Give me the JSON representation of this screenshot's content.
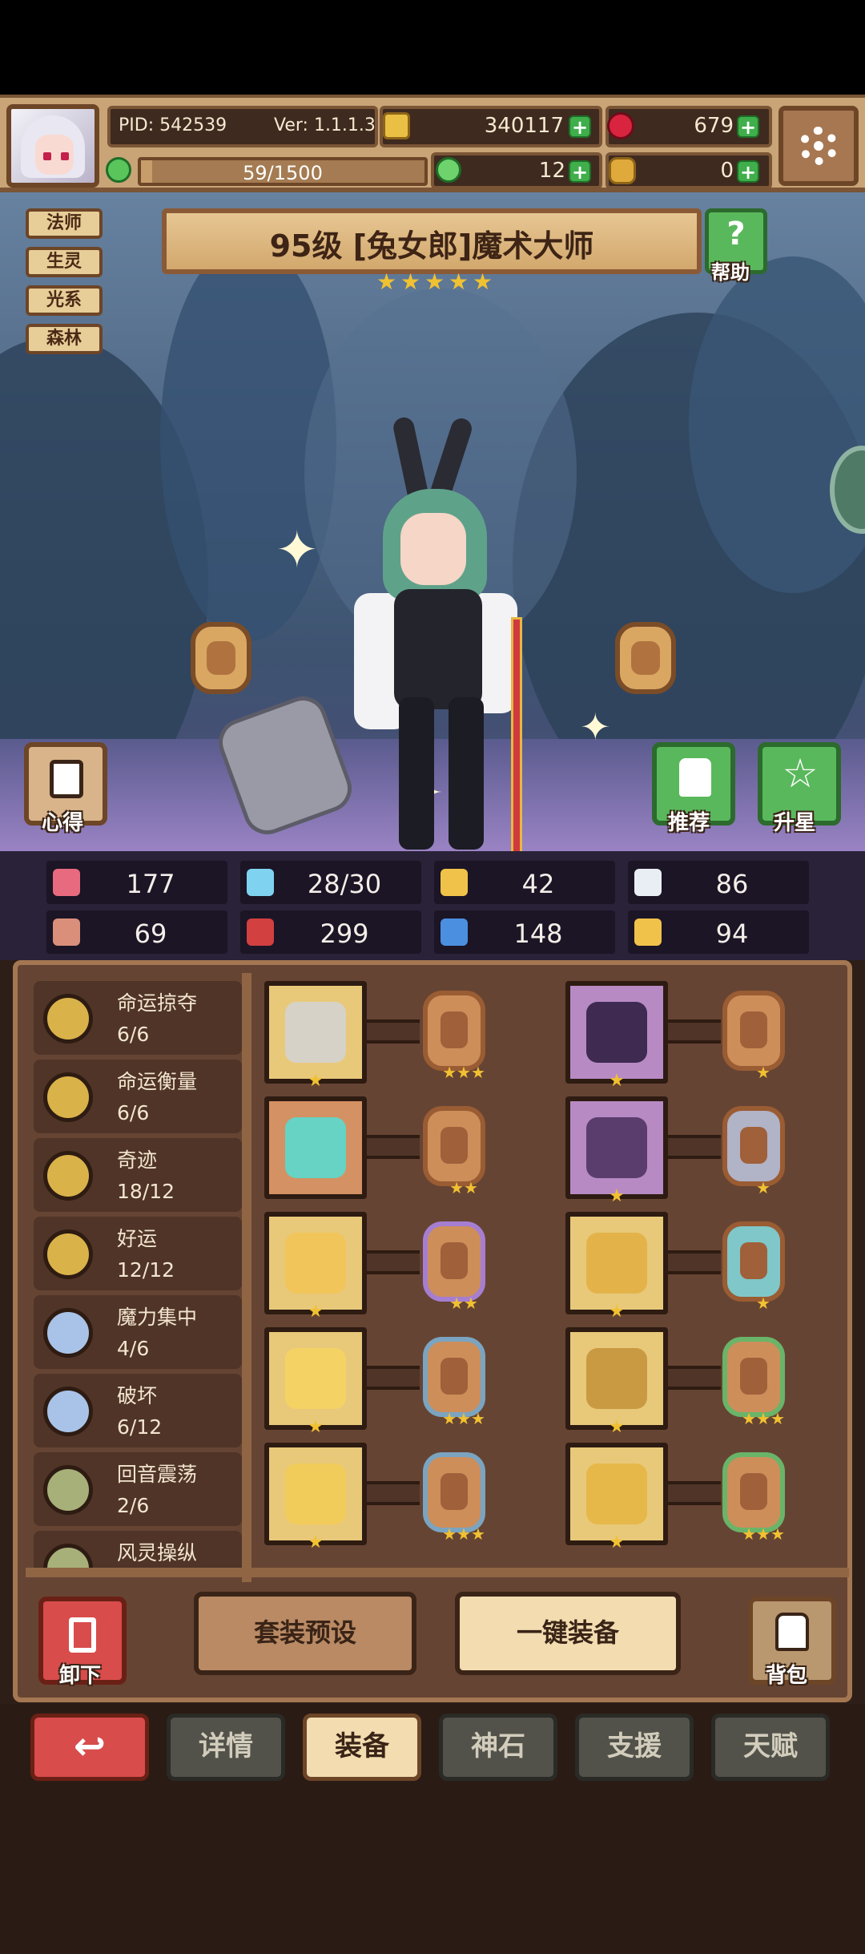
{
  "header": {
    "pid": "PID: 542539",
    "version": "Ver: 1.1.1.3",
    "gold": "340117",
    "gems": "679",
    "stamina": "59/1500",
    "stamina_fraction": 0.039,
    "clover": "12",
    "items": "0"
  },
  "tags": [
    "法师",
    "生灵",
    "光系",
    "森林"
  ],
  "hero": {
    "title": "95级  [兔女郎]魔术大师",
    "stars": 5,
    "help_label": "帮助"
  },
  "scene_buttons": {
    "notes": "心得",
    "recommend": "推荐",
    "star_up": "升星"
  },
  "stats": [
    {
      "icon": "heart-icon",
      "value": "177",
      "color": "#e86a7e"
    },
    {
      "icon": "drop-icon",
      "value": "28/30",
      "color": "#7fd3f0"
    },
    {
      "icon": "shield-icon",
      "value": "42",
      "color": "#f1c24a"
    },
    {
      "icon": "wing-icon",
      "value": "86",
      "color": "#e9eef5"
    },
    {
      "icon": "fist-icon",
      "value": "69",
      "color": "#d98f7a"
    },
    {
      "icon": "book-icon",
      "value": "299",
      "color": "#d24040"
    },
    {
      "icon": "boot-icon",
      "value": "148",
      "color": "#4b8fe0"
    },
    {
      "icon": "horseshoe-icon",
      "value": "94",
      "color": "#f1c24a"
    }
  ],
  "skills": [
    {
      "name": "命运掠夺",
      "value": "6/6",
      "color": "#d9b24a"
    },
    {
      "name": "命运衡量",
      "value": "6/6",
      "color": "#d9b24a"
    },
    {
      "name": "奇迹",
      "value": "18/12",
      "color": "#d9b24a"
    },
    {
      "name": "好运",
      "value": "12/12",
      "color": "#d9b24a"
    },
    {
      "name": "魔力集中",
      "value": "4/6",
      "color": "#a9c3e8"
    },
    {
      "name": "破坏",
      "value": "6/12",
      "color": "#a9c3e8"
    },
    {
      "name": "回音震荡",
      "value": "2/6",
      "color": "#a8b07a"
    },
    {
      "name": "风灵操纵",
      "value": "",
      "color": "#a8b07a"
    }
  ],
  "equipment": {
    "left": [
      {
        "icon": "axe-icon",
        "rarity": "gold",
        "stars": "★",
        "rune_border": "copper",
        "rune_stars": "★★★"
      },
      {
        "icon": "orb-icon",
        "rarity": "copper",
        "stars": "",
        "rune_border": "copper",
        "rune_stars": "★★"
      },
      {
        "icon": "necklace-icon",
        "rarity": "gold",
        "stars": "★",
        "rune_border": "violet",
        "rune_stars": "★★"
      },
      {
        "icon": "amulet-icon",
        "rarity": "gold",
        "stars": "★",
        "rune_border": "blue",
        "rune_stars": "★★★"
      },
      {
        "icon": "ring-icon",
        "rarity": "gold",
        "stars": "★",
        "rune_border": "blue",
        "rune_stars": "★★★"
      }
    ],
    "right": [
      {
        "icon": "witch-hat-icon",
        "rarity": "purple",
        "stars": "★",
        "rune_border": "copper",
        "rune_stars": "★"
      },
      {
        "icon": "armor-icon",
        "rarity": "purple",
        "stars": "★",
        "rune_border": "gray",
        "rune_stars": "★"
      },
      {
        "icon": "gauntlet-icon",
        "rarity": "gold",
        "stars": "★",
        "rune_border": "cyan",
        "rune_stars": "★"
      },
      {
        "icon": "belt-icon",
        "rarity": "gold",
        "stars": "★",
        "rune_border": "green",
        "rune_stars": "★★★"
      },
      {
        "icon": "boots-icon",
        "rarity": "gold",
        "stars": "★",
        "rune_border": "green",
        "rune_stars": "★★★"
      }
    ]
  },
  "actions": {
    "unequip": "卸下",
    "preset": "套装预设",
    "auto_equip": "一键装备",
    "bag": "背包"
  },
  "tabs": [
    "详情",
    "装备",
    "神石",
    "支援",
    "天赋"
  ],
  "active_tab": "装备"
}
